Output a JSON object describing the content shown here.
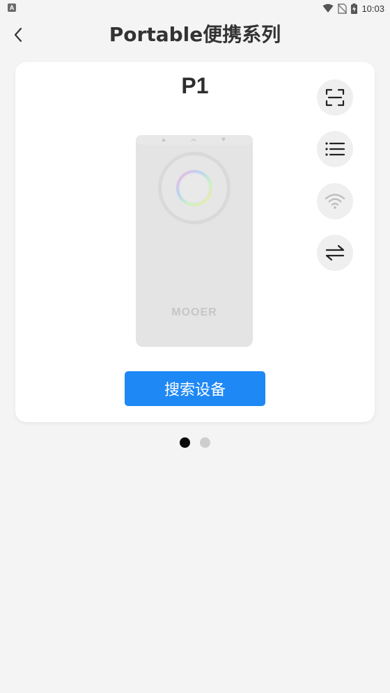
{
  "status_bar": {
    "app_icon_letter": "A",
    "time": "10:03"
  },
  "header": {
    "title": "Portable便携系列"
  },
  "card": {
    "device_name": "P1",
    "device_logo_text": "MOOER",
    "search_button_label": "搜索设备",
    "actions": [
      {
        "icon": "scan-icon"
      },
      {
        "icon": "list-icon"
      },
      {
        "icon": "wifi-icon"
      },
      {
        "icon": "switch-icon"
      }
    ]
  },
  "pager": {
    "total": 2,
    "active_index": 0
  },
  "colors": {
    "accent": "#1e88f5",
    "background": "#f4f4f4",
    "card": "#ffffff",
    "icon_bg": "#efefef"
  }
}
